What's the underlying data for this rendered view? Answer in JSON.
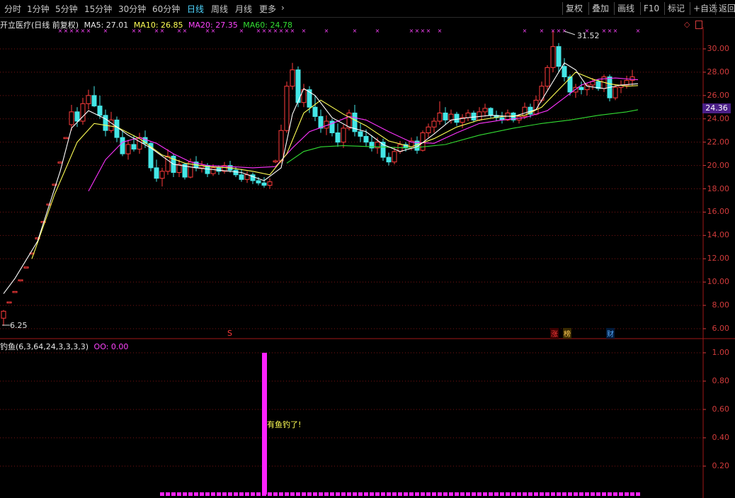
{
  "toolbar": {
    "periods": [
      "分时",
      "1分钟",
      "5分钟",
      "15分钟",
      "30分钟",
      "60分钟",
      "日线",
      "周线",
      "月线",
      "更多"
    ],
    "active_period": "日线",
    "more_arrow": "›",
    "right_buttons": [
      "复权",
      "叠加",
      "画线",
      "F10",
      "标记",
      "+自选",
      "返回"
    ]
  },
  "legend": {
    "stock": "开立医疗(日线 前复权)",
    "ma5": "MA5: 27.01",
    "ma10": "MA10: 26.85",
    "ma20": "MA20: 27.35",
    "ma60": "MA60: 24.78"
  },
  "colors": {
    "up": "#ff3b3b",
    "down": "#44e6e6",
    "ma5": "#ffffff",
    "ma10": "#ffff55",
    "ma20": "#ff33ff",
    "ma60": "#33dd33",
    "grid": "#7a1414",
    "axis_text": "#d23b3b",
    "indicator_bar": "#ff22ff"
  },
  "price_axis": {
    "ticks": [
      "30.00",
      "28.00",
      "26.00",
      "24.00",
      "22.00",
      "20.00",
      "18.00",
      "16.00",
      "14.00",
      "12.00",
      "10.00",
      "8.00",
      "6.00"
    ],
    "current_price": "24.36"
  },
  "annotations": {
    "high": "31.52",
    "low": "6.25",
    "markers": [
      {
        "label": "S",
        "color": "#ff3b3b"
      },
      {
        "label": "涨",
        "color": "#ff3b3b"
      },
      {
        "label": "榜",
        "color": "#ffcc55"
      },
      {
        "label": "财",
        "color": "#55aaff"
      }
    ]
  },
  "indicator": {
    "name": "钓鱼(6,3,64,24,3,3,3,3)",
    "value_label": "OO: 0.00",
    "signal_text": "有鱼钓了!",
    "ticks": [
      "1.00",
      "0.80",
      "0.60",
      "0.40",
      "0.20"
    ]
  },
  "chart_data": {
    "type": "candlestick",
    "ylim": [
      6,
      32
    ],
    "ohlc": [
      [
        6.9,
        7.6,
        6.25,
        7.5
      ],
      [
        8.2,
        8.3,
        8.2,
        8.3
      ],
      [
        9.1,
        9.2,
        9.1,
        9.2
      ],
      [
        10.1,
        10.2,
        10.1,
        10.2
      ],
      [
        11.2,
        11.3,
        11.2,
        11.3
      ],
      [
        12.4,
        12.5,
        12.4,
        12.5
      ],
      [
        13.7,
        13.8,
        13.7,
        13.8
      ],
      [
        15.1,
        15.2,
        15.1,
        15.2
      ],
      [
        16.6,
        16.7,
        16.6,
        16.7
      ],
      [
        18.3,
        18.4,
        18.3,
        18.4
      ],
      [
        20.2,
        20.3,
        20.2,
        20.3
      ],
      [
        22.3,
        22.4,
        22.3,
        22.4
      ],
      [
        23.5,
        25.2,
        23.0,
        24.6
      ],
      [
        24.6,
        25.0,
        23.3,
        23.8
      ],
      [
        23.8,
        25.8,
        23.5,
        25.3
      ],
      [
        25.3,
        26.5,
        24.8,
        26.0
      ],
      [
        26.0,
        26.8,
        25.0,
        25.1
      ],
      [
        25.1,
        26.0,
        24.0,
        24.3
      ],
      [
        24.3,
        24.8,
        22.5,
        23.0
      ],
      [
        23.0,
        24.6,
        22.8,
        23.9
      ],
      [
        23.9,
        24.2,
        22.0,
        22.4
      ],
      [
        22.4,
        23.0,
        20.8,
        21.0
      ],
      [
        21.0,
        22.2,
        20.5,
        21.8
      ],
      [
        21.8,
        22.6,
        21.2,
        21.4
      ],
      [
        21.4,
        22.8,
        21.0,
        22.4
      ],
      [
        22.4,
        23.0,
        21.5,
        21.9
      ],
      [
        21.9,
        22.0,
        19.5,
        19.8
      ],
      [
        19.8,
        20.5,
        18.6,
        18.9
      ],
      [
        18.9,
        19.8,
        18.2,
        19.5
      ],
      [
        19.5,
        21.4,
        19.2,
        20.8
      ],
      [
        20.8,
        21.0,
        19.0,
        19.4
      ],
      [
        19.4,
        20.5,
        19.0,
        20.1
      ],
      [
        20.1,
        20.2,
        18.8,
        19.0
      ],
      [
        19.0,
        20.6,
        18.9,
        20.3
      ],
      [
        20.3,
        20.8,
        19.5,
        19.8
      ],
      [
        19.8,
        20.4,
        19.4,
        20.0
      ],
      [
        20.0,
        20.2,
        19.0,
        19.3
      ],
      [
        19.3,
        20.1,
        19.1,
        19.8
      ],
      [
        19.8,
        20.0,
        19.2,
        19.5
      ],
      [
        19.5,
        20.3,
        19.3,
        20.0
      ],
      [
        20.0,
        20.4,
        19.4,
        19.6
      ],
      [
        19.6,
        19.9,
        19.0,
        19.2
      ],
      [
        19.2,
        19.7,
        18.6,
        18.8
      ],
      [
        18.8,
        19.5,
        18.5,
        19.2
      ],
      [
        19.2,
        19.4,
        18.4,
        18.7
      ],
      [
        18.7,
        19.0,
        18.3,
        18.5
      ],
      [
        18.5,
        19.0,
        18.1,
        18.3
      ],
      [
        18.3,
        18.9,
        18.0,
        18.6
      ],
      [
        20.3,
        20.5,
        20.2,
        20.4
      ],
      [
        20.4,
        23.5,
        20.2,
        23.0
      ],
      [
        23.0,
        27.2,
        22.8,
        26.8
      ],
      [
        26.8,
        28.8,
        26.5,
        28.2
      ],
      [
        28.2,
        28.5,
        25.0,
        25.4
      ],
      [
        25.4,
        27.0,
        25.0,
        26.5
      ],
      [
        26.5,
        26.8,
        24.5,
        25.0
      ],
      [
        25.0,
        26.0,
        23.8,
        24.2
      ],
      [
        24.2,
        24.8,
        22.8,
        23.2
      ],
      [
        23.2,
        24.3,
        22.6,
        23.8
      ],
      [
        23.8,
        24.0,
        22.5,
        22.8
      ],
      [
        22.8,
        23.6,
        21.6,
        22.0
      ],
      [
        22.0,
        23.5,
        21.5,
        23.2
      ],
      [
        23.2,
        24.8,
        23.0,
        24.5
      ],
      [
        24.5,
        25.2,
        22.5,
        22.9
      ],
      [
        22.9,
        23.6,
        22.0,
        22.5
      ],
      [
        22.5,
        23.1,
        21.6,
        22.0
      ],
      [
        22.0,
        22.6,
        21.2,
        21.5
      ],
      [
        21.5,
        22.4,
        21.0,
        22.0
      ],
      [
        22.0,
        22.3,
        20.4,
        20.7
      ],
      [
        20.7,
        21.1,
        20.0,
        20.3
      ],
      [
        20.3,
        21.6,
        20.1,
        21.2
      ],
      [
        21.2,
        22.1,
        21.0,
        21.8
      ],
      [
        21.8,
        22.0,
        21.2,
        21.5
      ],
      [
        21.5,
        22.4,
        21.3,
        22.1
      ],
      [
        22.1,
        22.5,
        21.0,
        21.3
      ],
      [
        21.3,
        23.0,
        21.2,
        22.8
      ],
      [
        22.8,
        23.6,
        22.4,
        23.3
      ],
      [
        23.3,
        24.1,
        22.8,
        23.8
      ],
      [
        23.8,
        25.5,
        23.5,
        24.5
      ],
      [
        24.5,
        25.0,
        23.5,
        23.9
      ],
      [
        23.9,
        24.8,
        23.6,
        24.4
      ],
      [
        24.4,
        24.6,
        23.4,
        23.7
      ],
      [
        23.7,
        24.4,
        23.2,
        24.1
      ],
      [
        24.1,
        24.8,
        23.8,
        24.5
      ],
      [
        24.5,
        24.7,
        23.7,
        23.9
      ],
      [
        23.9,
        25.0,
        23.8,
        24.6
      ],
      [
        24.6,
        25.3,
        24.2,
        24.9
      ],
      [
        24.9,
        25.0,
        24.1,
        24.3
      ],
      [
        24.3,
        24.7,
        23.8,
        24.1
      ],
      [
        24.1,
        24.6,
        23.6,
        23.9
      ],
      [
        23.9,
        24.8,
        23.8,
        24.5
      ],
      [
        24.5,
        24.6,
        23.7,
        23.9
      ],
      [
        23.9,
        24.4,
        23.6,
        24.2
      ],
      [
        24.2,
        25.4,
        24.0,
        25.0
      ],
      [
        25.0,
        25.3,
        24.1,
        24.4
      ],
      [
        24.4,
        26.0,
        24.3,
        25.6
      ],
      [
        25.6,
        27.2,
        25.4,
        26.8
      ],
      [
        26.8,
        28.6,
        26.5,
        28.4
      ],
      [
        28.4,
        31.52,
        28.0,
        30.2
      ],
      [
        30.2,
        30.5,
        28.0,
        28.5
      ],
      [
        28.5,
        29.2,
        27.2,
        27.6
      ],
      [
        27.6,
        27.8,
        26.0,
        26.3
      ],
      [
        26.3,
        27.0,
        25.8,
        26.7
      ],
      [
        26.7,
        27.2,
        26.1,
        26.5
      ],
      [
        26.5,
        27.1,
        26.0,
        26.9
      ],
      [
        26.9,
        27.5,
        26.5,
        27.2
      ],
      [
        27.2,
        27.4,
        26.4,
        26.6
      ],
      [
        26.6,
        27.8,
        26.3,
        27.6
      ],
      [
        27.6,
        27.8,
        25.5,
        25.8
      ],
      [
        25.8,
        26.9,
        25.6,
        26.7
      ],
      [
        26.7,
        27.3,
        26.2,
        26.9
      ],
      [
        26.9,
        27.7,
        26.6,
        27.3
      ],
      [
        27.3,
        28.2,
        26.8,
        27.6
      ]
    ],
    "ma5": [
      [
        0,
        9.0
      ],
      [
        2,
        10.3
      ],
      [
        6,
        13.5
      ],
      [
        10,
        19.5
      ],
      [
        12,
        23.2
      ],
      [
        15,
        24.7
      ],
      [
        18,
        24.0
      ],
      [
        22,
        22.6
      ],
      [
        26,
        21.5
      ],
      [
        30,
        20.1
      ],
      [
        34,
        19.8
      ],
      [
        38,
        19.6
      ],
      [
        42,
        19.4
      ],
      [
        46,
        18.7
      ],
      [
        49,
        19.8
      ],
      [
        51,
        24.4
      ],
      [
        53,
        26.6
      ],
      [
        55,
        26.0
      ],
      [
        58,
        24.1
      ],
      [
        61,
        23.3
      ],
      [
        64,
        22.9
      ],
      [
        67,
        21.8
      ],
      [
        70,
        21.2
      ],
      [
        73,
        21.6
      ],
      [
        76,
        22.7
      ],
      [
        79,
        23.9
      ],
      [
        82,
        24.1
      ],
      [
        86,
        24.3
      ],
      [
        90,
        24.2
      ],
      [
        94,
        24.8
      ],
      [
        97,
        27.2
      ],
      [
        99,
        28.8
      ],
      [
        101,
        28.2
      ],
      [
        103,
        26.8
      ],
      [
        106,
        26.6
      ],
      [
        109,
        26.9
      ],
      [
        112,
        27.01
      ]
    ],
    "ma10": [
      [
        5,
        12.0
      ],
      [
        9,
        17.5
      ],
      [
        13,
        22.0
      ],
      [
        16,
        23.6
      ],
      [
        20,
        23.3
      ],
      [
        24,
        22.3
      ],
      [
        28,
        20.9
      ],
      [
        32,
        20.2
      ],
      [
        36,
        19.9
      ],
      [
        40,
        19.8
      ],
      [
        44,
        19.5
      ],
      [
        47,
        19.2
      ],
      [
        50,
        21.0
      ],
      [
        53,
        24.5
      ],
      [
        56,
        25.6
      ],
      [
        60,
        24.4
      ],
      [
        64,
        23.4
      ],
      [
        68,
        22.1
      ],
      [
        72,
        21.6
      ],
      [
        76,
        22.3
      ],
      [
        80,
        23.3
      ],
      [
        84,
        23.9
      ],
      [
        88,
        24.2
      ],
      [
        92,
        24.3
      ],
      [
        95,
        25.0
      ],
      [
        98,
        26.5
      ],
      [
        101,
        28.0
      ],
      [
        104,
        27.4
      ],
      [
        107,
        27.0
      ],
      [
        110,
        26.8
      ],
      [
        112,
        26.85
      ]
    ],
    "ma20": [
      [
        15,
        17.8
      ],
      [
        18,
        20.5
      ],
      [
        21,
        22.0
      ],
      [
        24,
        22.4
      ],
      [
        27,
        21.9
      ],
      [
        30,
        21.0
      ],
      [
        33,
        20.3
      ],
      [
        36,
        20.0
      ],
      [
        40,
        19.9
      ],
      [
        44,
        19.8
      ],
      [
        48,
        19.9
      ],
      [
        51,
        21.5
      ],
      [
        54,
        22.9
      ],
      [
        58,
        23.6
      ],
      [
        61,
        24.2
      ],
      [
        64,
        23.9
      ],
      [
        68,
        22.9
      ],
      [
        72,
        22.0
      ],
      [
        76,
        21.9
      ],
      [
        80,
        22.8
      ],
      [
        84,
        23.6
      ],
      [
        88,
        23.9
      ],
      [
        92,
        24.1
      ],
      [
        96,
        24.7
      ],
      [
        99,
        25.8
      ],
      [
        102,
        26.9
      ],
      [
        105,
        27.4
      ],
      [
        108,
        27.5
      ],
      [
        112,
        27.35
      ]
    ],
    "ma60": [
      [
        50,
        20.2
      ],
      [
        53,
        21.2
      ],
      [
        56,
        21.6
      ],
      [
        60,
        21.7
      ],
      [
        66,
        21.6
      ],
      [
        72,
        21.5
      ],
      [
        78,
        21.8
      ],
      [
        84,
        22.6
      ],
      [
        90,
        23.2
      ],
      [
        95,
        23.6
      ],
      [
        100,
        23.9
      ],
      [
        105,
        24.3
      ],
      [
        110,
        24.6
      ],
      [
        112,
        24.78
      ]
    ],
    "indicator_values": {
      "signal_index": 46,
      "signal_value": 1.0,
      "baseline": 0.0
    }
  }
}
